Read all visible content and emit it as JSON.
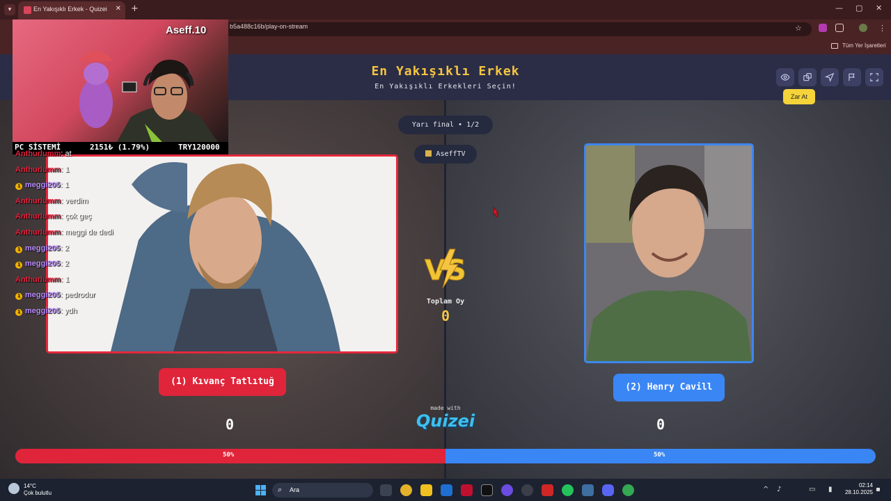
{
  "browser": {
    "tab_title": "En Yakışıklı Erkek - Quizei",
    "tab_close": "✕",
    "new_tab": "+",
    "url": "b5a488c16b/play-on-stream",
    "bookmarks_label": "Tüm Yer İşaretleri"
  },
  "app": {
    "title": "En Yakışıklı Erkek",
    "subtitle": "En Yakışıklı Erkekleri Seçin!",
    "tooltip": "Zar At",
    "round": "Yarı final • 1/2",
    "streamer": "AseffTV",
    "total_label": "Toplam Oy",
    "total_value": "0",
    "made_with": "made with",
    "logo": "Quizei",
    "left": {
      "name": "(1) Kıvanç Tatlıtuğ",
      "score": "0",
      "percent_label": "50%",
      "share": 0.5
    },
    "right": {
      "name": "(2) Henry Cavill",
      "score": "0",
      "percent_label": "50%"
    },
    "colors": {
      "left": "#e0243a",
      "right": "#3a86f5",
      "title": "#f5c542"
    }
  },
  "webcam": {
    "name": "Aseff.10",
    "label": "PC SİSTEMİ",
    "stat": "2151₺ (1.79%)",
    "goal": "TRY120000"
  },
  "chat": [
    {
      "user": "Anthurlumm",
      "color": "red",
      "badge": false,
      "msg": ": at"
    },
    {
      "user": "Anthurlumm",
      "color": "red",
      "badge": false,
      "msg": ": 1"
    },
    {
      "user": "meggi205",
      "color": "purple",
      "badge": true,
      "msg": ": 1"
    },
    {
      "user": "Anthurlumm",
      "color": "red",
      "badge": false,
      "msg": ": verdim"
    },
    {
      "user": "Anthurlumm",
      "color": "red",
      "badge": false,
      "msg": ": çok geç"
    },
    {
      "user": "Anthurlumm",
      "color": "red",
      "badge": false,
      "msg": ": meggi de dedi"
    },
    {
      "user": "meggi205",
      "color": "purple",
      "badge": true,
      "msg": ": 2"
    },
    {
      "user": "meggi205",
      "color": "purple",
      "badge": true,
      "msg": ": 2"
    },
    {
      "user": "Anthurlumm",
      "color": "red",
      "badge": false,
      "msg": ": 1"
    },
    {
      "user": "meggi205",
      "color": "purple",
      "badge": true,
      "msg": ": pedrodur"
    },
    {
      "user": "meggi205",
      "color": "purple",
      "badge": true,
      "msg": ": ydh"
    }
  ],
  "taskbar": {
    "temp": "14°C",
    "weather": "Çok bulutlu",
    "search": "Ara",
    "time": "02:14",
    "date": "28.10.2025"
  },
  "icons": {
    "eye": "eye-icon",
    "dice": "dice-icon",
    "send": "send-icon",
    "flag": "flag-icon",
    "fullscreen": "fullscreen-icon"
  }
}
